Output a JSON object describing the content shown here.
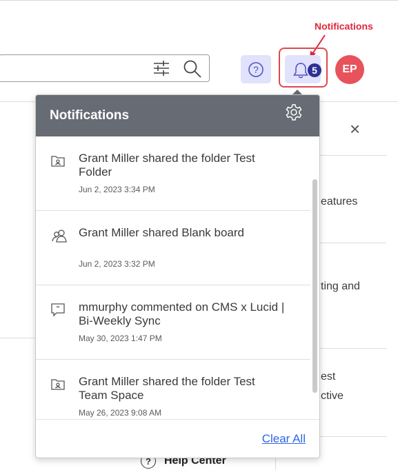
{
  "callout": {
    "label": "Notifications"
  },
  "header": {
    "avatar_initials": "EP",
    "notification_count": "5"
  },
  "background_panel": {
    "close_symbol": "×",
    "text_fragments": [
      "eatures",
      "ting and",
      "est",
      "ctive"
    ],
    "help_center": {
      "icon_glyph": "?",
      "label": "Help Center"
    }
  },
  "notifications": {
    "title": "Notifications",
    "items": [
      {
        "icon": "shared-folder-icon",
        "message": "Grant Miller shared the folder Test Folder",
        "time": "Jun 2, 2023 3:34 PM"
      },
      {
        "icon": "shared-users-icon",
        "message": "Grant Miller shared Blank board",
        "time": "Jun 2, 2023 3:32 PM"
      },
      {
        "icon": "comment-icon",
        "message": "mmurphy commented on CMS x Lucid | Bi-Weekly Sync",
        "time": "May 30, 2023 1:47 PM"
      },
      {
        "icon": "shared-folder-icon",
        "message": "Grant Miller shared the folder Test Team Space",
        "time": "May 26, 2023 9:08 AM"
      }
    ],
    "clear_all_label": "Clear All"
  },
  "colors": {
    "accent_red": "#e0474c",
    "avatar_red": "#e8525b",
    "badge_blue": "#2e3192",
    "header_gray": "#666b74",
    "link_blue": "#2e66e6",
    "button_lavender": "#e1e2fb"
  }
}
